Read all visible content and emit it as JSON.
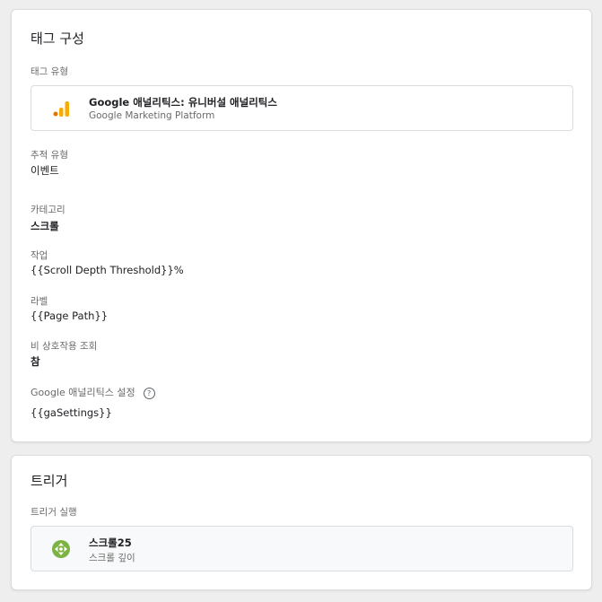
{
  "tag_config": {
    "title": "태그 구성",
    "tag_type_label": "태그 유형",
    "tag_type": {
      "name": "Google 애널리틱스: 유니버설 애널리틱스",
      "provider": "Google Marketing Platform",
      "icon": "analytics-bars-icon",
      "icon_color": "#f9ab00"
    },
    "track_type_label": "추적 유형",
    "track_type_value": "이벤트",
    "category_label": "카테고리",
    "category_value": "스크롤",
    "action_label": "작업",
    "action_value": "{{Scroll Depth Threshold}}%",
    "label_label": "라벨",
    "label_value": "{{Page Path}}",
    "non_interaction_label": "비 상호작용 조회",
    "non_interaction_value": "참",
    "ga_settings_label": "Google 애널리틱스 설정",
    "ga_settings_value": "{{gaSettings}}"
  },
  "triggering": {
    "title": "트리거",
    "fire_label": "트리거 실행",
    "trigger": {
      "name": "스크롤25",
      "type": "스크롤 깊이",
      "icon": "scroll-depth-icon",
      "icon_color": "#7cb342"
    }
  }
}
